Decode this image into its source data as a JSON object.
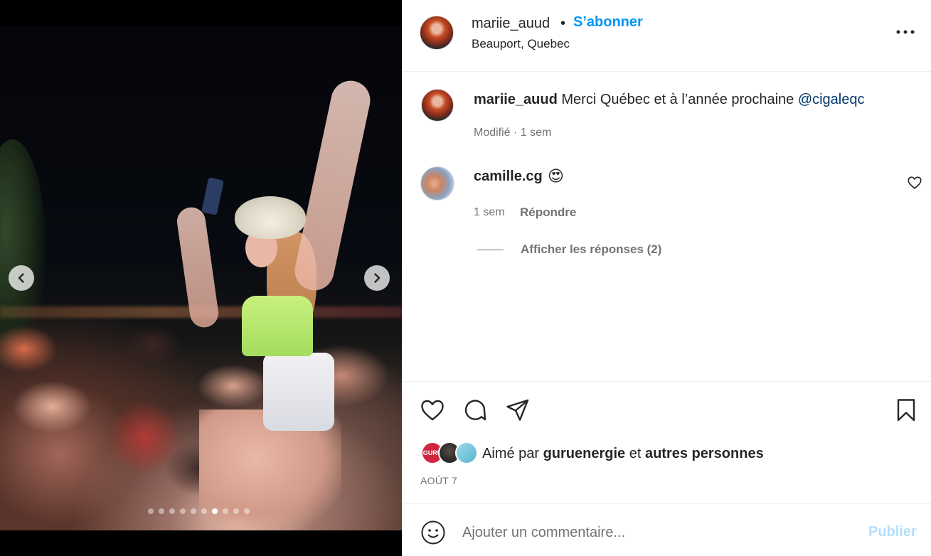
{
  "post": {
    "username": "mariie_auud",
    "separator": "•",
    "follow_label": "S’abonner",
    "location": "Beauport, Quebec"
  },
  "caption": {
    "username": "mariie_auud",
    "text": "Merci Québec et à l’année prochaine ",
    "mention": "@cigaleqc",
    "meta": "Modifié · 1 sem"
  },
  "comments": [
    {
      "username": "camille.cg",
      "text": "😍",
      "time": "1 sem",
      "reply_label": "Répondre",
      "replies_label": "Afficher les réponses (2)"
    }
  ],
  "likes": {
    "prefix": "Aimé par ",
    "first_liker": "guruenergie",
    "middle": " et ",
    "others": "autres personnes",
    "avatar_badge": "GURU"
  },
  "date": "AOÛT 7",
  "comment_box": {
    "placeholder": "Ajouter un commentaire...",
    "post_label": "Publier"
  },
  "carousel": {
    "total_slides": 10,
    "active_index": 6
  },
  "colors": {
    "accent": "#0095f6",
    "mention": "#00376b",
    "post_disabled": "#b2dffc",
    "muted": "#737373"
  },
  "icons": [
    "chevron-left-icon",
    "chevron-right-icon",
    "more-icon",
    "heart-icon",
    "comment-icon",
    "share-icon",
    "bookmark-icon",
    "emoji-icon"
  ]
}
